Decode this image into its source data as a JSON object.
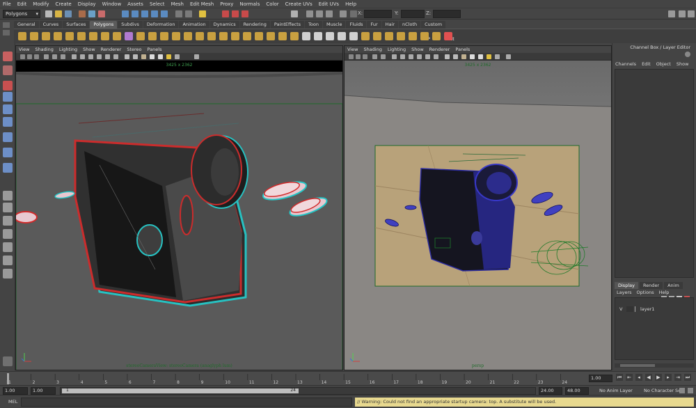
{
  "menubar": [
    "File",
    "Edit",
    "Modify",
    "Create",
    "Display",
    "Window",
    "Assets",
    "Select",
    "Mesh",
    "Edit Mesh",
    "Proxy",
    "Normals",
    "Color",
    "Create UVs",
    "Edit UVs",
    "Help"
  ],
  "status_line": {
    "mode": "Polygons",
    "x_label": "X:",
    "y_label": "Y:",
    "z_label": "Z:"
  },
  "shelf_tabs": [
    {
      "label": "General",
      "active": false
    },
    {
      "label": "Curves",
      "active": false
    },
    {
      "label": "Surfaces",
      "active": false
    },
    {
      "label": "Polygons",
      "active": true
    },
    {
      "label": "Subdivs",
      "active": false
    },
    {
      "label": "Deformation",
      "active": false
    },
    {
      "label": "Animation",
      "active": false
    },
    {
      "label": "Dynamics",
      "active": false
    },
    {
      "label": "Rendering",
      "active": false
    },
    {
      "label": "PaintEffects",
      "active": false
    },
    {
      "label": "Toon",
      "active": false
    },
    {
      "label": "Muscle",
      "active": false
    },
    {
      "label": "Fluids",
      "active": false
    },
    {
      "label": "Fur",
      "active": false
    },
    {
      "label": "Hair",
      "active": false
    },
    {
      "label": "nCloth",
      "active": false
    },
    {
      "label": "Custom",
      "active": false
    }
  ],
  "shelf_labels": {
    "ft": "FT",
    "cp": "CP",
    "hist": "Hist"
  },
  "left_panel": {
    "menu": [
      "View",
      "Shading",
      "Lighting",
      "Show",
      "Renderer",
      "Stereo",
      "Panels"
    ],
    "resolution": "3425 x 2362",
    "camera_label": "stereoCameraView: stereoCamera (anaglyph lum)"
  },
  "right_panel": {
    "menu": [
      "View",
      "Shading",
      "Lighting",
      "Show",
      "Renderer",
      "Panels"
    ],
    "resolution": "3425 x 2362",
    "camera_label": "persp"
  },
  "channel_box": {
    "title": "Channel Box / Layer Editor",
    "menu": [
      "Channels",
      "Edit",
      "Object",
      "Show"
    ],
    "layer_tabs": [
      {
        "label": "Display",
        "active": true
      },
      {
        "label": "Render",
        "active": false
      },
      {
        "label": "Anim",
        "active": false
      }
    ],
    "layer_menu": [
      "Layers",
      "Options",
      "Help"
    ],
    "layer": {
      "visibility": "V",
      "name": "layer1"
    }
  },
  "timeline": {
    "ticks": [
      "1",
      "2",
      "3",
      "4",
      "5",
      "6",
      "7",
      "8",
      "9",
      "10",
      "11",
      "12",
      "13",
      "14",
      "15",
      "16",
      "17",
      "18",
      "19",
      "20",
      "21",
      "22",
      "23",
      "24"
    ],
    "current_frame": "1.00"
  },
  "range": {
    "start": "1.00",
    "start2": "1.00",
    "range_start": "1",
    "range_end": "24",
    "end": "24.00",
    "end2": "48.00",
    "anim_layer": "No Anim Layer",
    "character_set": "No Character Set"
  },
  "command_line": {
    "label": "MEL",
    "warning": "// Warning: Could not find an appropriate startup camera: top.  A substitute will be used."
  },
  "colors": {
    "background": "#444444",
    "viewport_left": "#5a5a5a",
    "viewport_right": "#6e6e6e",
    "accent": "#5b5b5b",
    "warning_bg": "#e8d98f",
    "resolution_gate": "#1f6b2a"
  }
}
